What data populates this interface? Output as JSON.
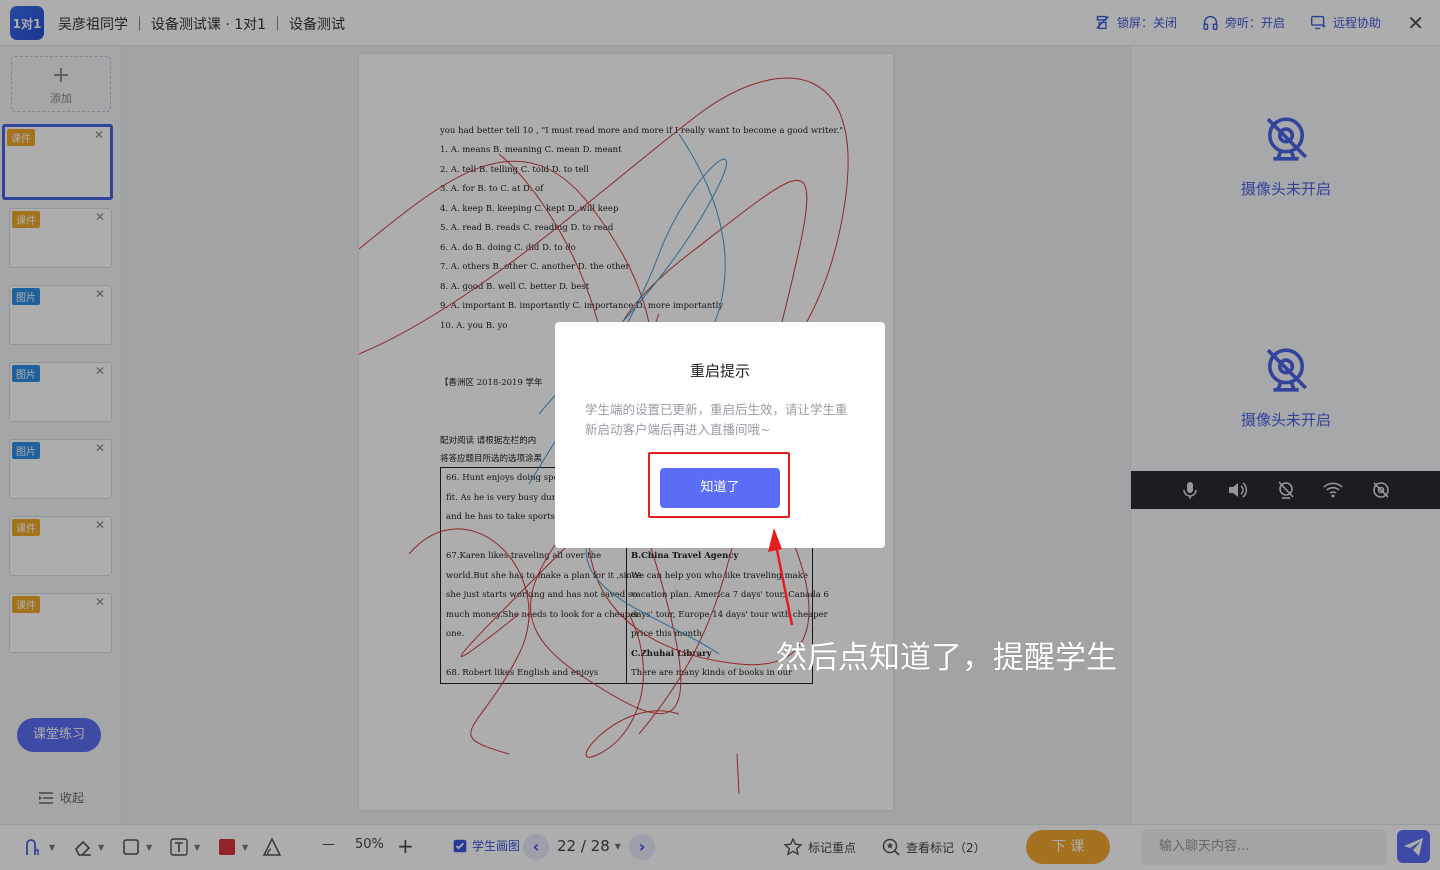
{
  "topbar": {
    "logo_text": "1对1",
    "breadcrumb": "吴彦祖同学 ｜ 设备测试课 · 1对1 ｜ 设备测试",
    "lock_screen": "锁屏：关闭",
    "listen": "旁听：开启",
    "remote_help": "远程协助",
    "close": "✕"
  },
  "sidebar": {
    "add_label": "添加",
    "add_symbol": "+",
    "items": [
      {
        "tag": "课件",
        "kind": "kj"
      },
      {
        "tag": "课件",
        "kind": "kj"
      },
      {
        "tag": "图片",
        "kind": "tp"
      },
      {
        "tag": "图片",
        "kind": "tp"
      },
      {
        "tag": "图片",
        "kind": "tp"
      },
      {
        "tag": "课件",
        "kind": "kj"
      },
      {
        "tag": "课件",
        "kind": "kj"
      }
    ],
    "close_symbol": "✕",
    "practice": "课堂练习",
    "collapse": "收起"
  },
  "document": {
    "lines": [
      "you had better tell   10   , \"I must read more and more if I really want to become a good writer.\"",
      "1. A. means          B. meaning          C. mean          D. meant",
      "2. A. tell             B. telling            C. told           D. to tell",
      "3. A. for              B. to                 C. at              D. of",
      "4. A. keep           B. keeping          C. kept           D. will keep",
      "5. A. read            B. reads             C. reading       D. to read",
      "6. A. do              B. doing              C. did             D. to do",
      "7. A. others         B. other              C. another       D. the other",
      "8. A. good           B. well                C. better         D. best",
      "9. A. important    B. importantly     C. importance   D. more importantly",
      "10. A. you           B. yo"
    ],
    "section_heading": "【香洲区  2018-2019  学年",
    "instruction_1": "配对阅读    请根据左栏的内",
    "instruction_2": "将答应题目所选的选项涂黑",
    "left_col": [
      "66. Hunt enjoys doing sports",
      "fit. As he is very busy during",
      "and he has to take sports on",
      "",
      "67.Karen likes traveling all over the",
      "world.But she has to make a plan for it ,since",
      "she just starts working and has not saved so",
      "much money.She needs to look for a cheaper",
      "one.",
      "",
      "68.  Robert likes English and enjoys"
    ],
    "right_col": [
      "B.China Travel Agency",
      "  We can help you who like traveling make",
      "vacation plan. America 7 days' tour, Canada 6",
      "days' tour, Europe 14 days' tour with cheaper",
      "price this month",
      "C.Zhuhai Library",
      "  There are many kinds of books in our"
    ]
  },
  "right_panel": {
    "camera_off_1": "摄像头未开启",
    "camera_off_2": "摄像头未开启"
  },
  "toolbar": {
    "zoom_minus": "—",
    "zoom": "50%",
    "zoom_plus": "+",
    "student_draw": "学生画图",
    "page": "22 / 28",
    "prev": "‹",
    "next": "›",
    "mark_key": "标记重点",
    "view_marks": "查看标记（2）",
    "end_class": "下  课",
    "chat_placeholder": "输入聊天内容..."
  },
  "modal": {
    "title": "重启提示",
    "message": "学生端的设置已更新，重启后生效，请让学生重新启动客户端后再进入直播间哦~",
    "ok": "知道了"
  },
  "annotation": "然后点知道了，提醒学生",
  "colors": {
    "accent": "#5c6ef8",
    "brand_blue": "#4a64e6",
    "highlight_red": "#e41d1d",
    "end_class_orange": "#f2a830"
  }
}
